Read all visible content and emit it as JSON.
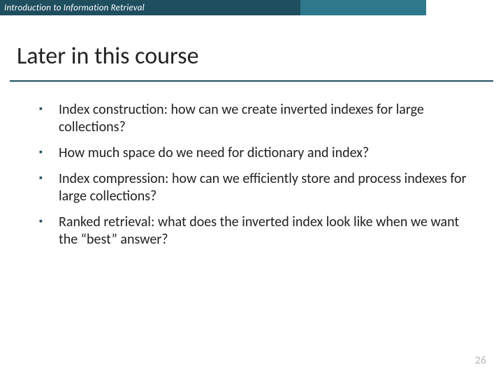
{
  "header": {
    "course": "Introduction to Information Retrieval"
  },
  "title": "Later in this course",
  "bullets": [
    "Index construction: how can we create inverted indexes for large collections?",
    "How much space do we need for dictionary and index?",
    "Index compression: how can we efficiently store and process indexes for large collections?",
    "Ranked retrieval: what does the inverted index look like when we want the “best” answer?"
  ],
  "page_number": "26"
}
